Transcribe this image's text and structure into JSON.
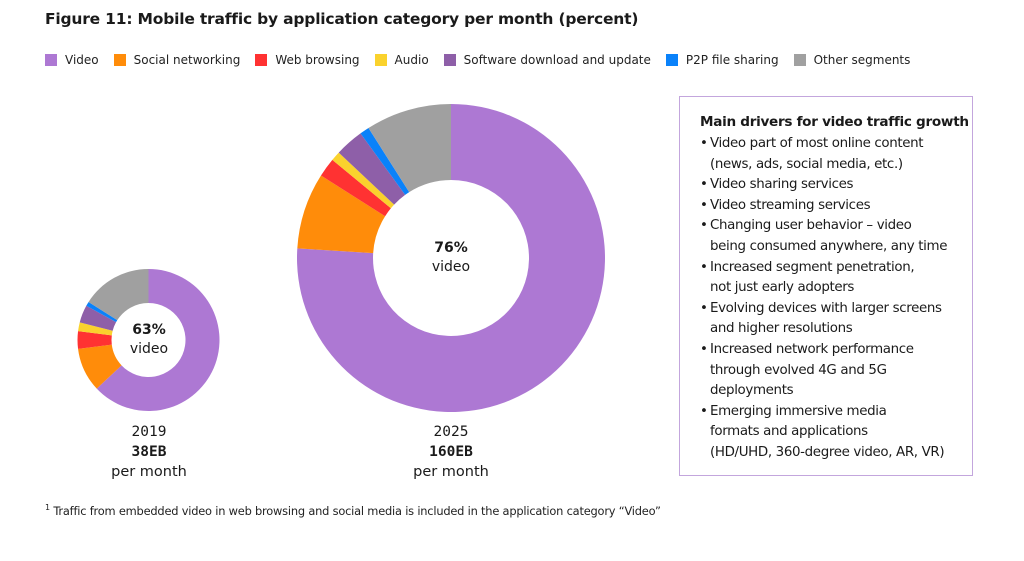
{
  "title": "Figure 11: Mobile traffic by application category per month (percent)",
  "legend": [
    {
      "label": "Video",
      "color": "#ad78d3"
    },
    {
      "label": "Social networking",
      "color": "#ff8c0a"
    },
    {
      "label": "Web browsing",
      "color": "#ff3232"
    },
    {
      "label": "Audio",
      "color": "#fad22d"
    },
    {
      "label": "Software download and update",
      "color": "#8e5fa8"
    },
    {
      "label": "P2P file sharing",
      "color": "#0a82fa"
    },
    {
      "label": "Other segments",
      "color": "#a0a0a0"
    }
  ],
  "chart_data": [
    {
      "type": "pie",
      "variant": "donut",
      "title": "2019",
      "total": "38EB",
      "total_unit": "per month",
      "center_label": {
        "value": "63%",
        "text": "video"
      },
      "categories": [
        "Video",
        "Social networking",
        "Web browsing",
        "Audio",
        "Software download and update",
        "P2P file sharing",
        "Other segments"
      ],
      "values": [
        63,
        10,
        4,
        2,
        4,
        1,
        16
      ],
      "colors": [
        "#ad78d3",
        "#ff8c0a",
        "#ff3232",
        "#fad22d",
        "#8e5fa8",
        "#0a82fa",
        "#a0a0a0"
      ],
      "start": "12 o'clock",
      "direction": "clockwise"
    },
    {
      "type": "pie",
      "variant": "donut",
      "title": "2025",
      "total": "160EB",
      "total_unit": "per month",
      "center_label": {
        "value": "76%",
        "text": "video"
      },
      "categories": [
        "Video",
        "Social networking",
        "Web browsing",
        "Audio",
        "Software download and update",
        "P2P file sharing",
        "Other segments"
      ],
      "values": [
        76,
        8,
        2,
        1,
        3,
        1,
        9
      ],
      "colors": [
        "#ad78d3",
        "#ff8c0a",
        "#ff3232",
        "#fad22d",
        "#8e5fa8",
        "#0a82fa",
        "#a0a0a0"
      ],
      "start": "12 o'clock",
      "direction": "clockwise"
    }
  ],
  "drivers_box": {
    "title": "Main drivers for video traffic growth",
    "items": [
      [
        "Video part of most online content",
        "(news, ads, social media, etc.)"
      ],
      [
        "Video sharing services"
      ],
      [
        "Video streaming services"
      ],
      [
        "Changing user behavior – video",
        "being consumed anywhere, any time"
      ],
      [
        "Increased segment penetration,",
        "not just early adopters"
      ],
      [
        "Evolving devices with larger screens",
        "and higher resolutions"
      ],
      [
        "Increased network performance",
        "through evolved 4G and 5G",
        "deployments"
      ],
      [
        "Emerging immersive media",
        "formats and applications",
        "(HD/UHD, 360-degree video, AR, VR)"
      ]
    ]
  },
  "footnote": {
    "marker": "1",
    "text": "Traffic from embedded video in web browsing and social media is included in the application category “Video”"
  }
}
